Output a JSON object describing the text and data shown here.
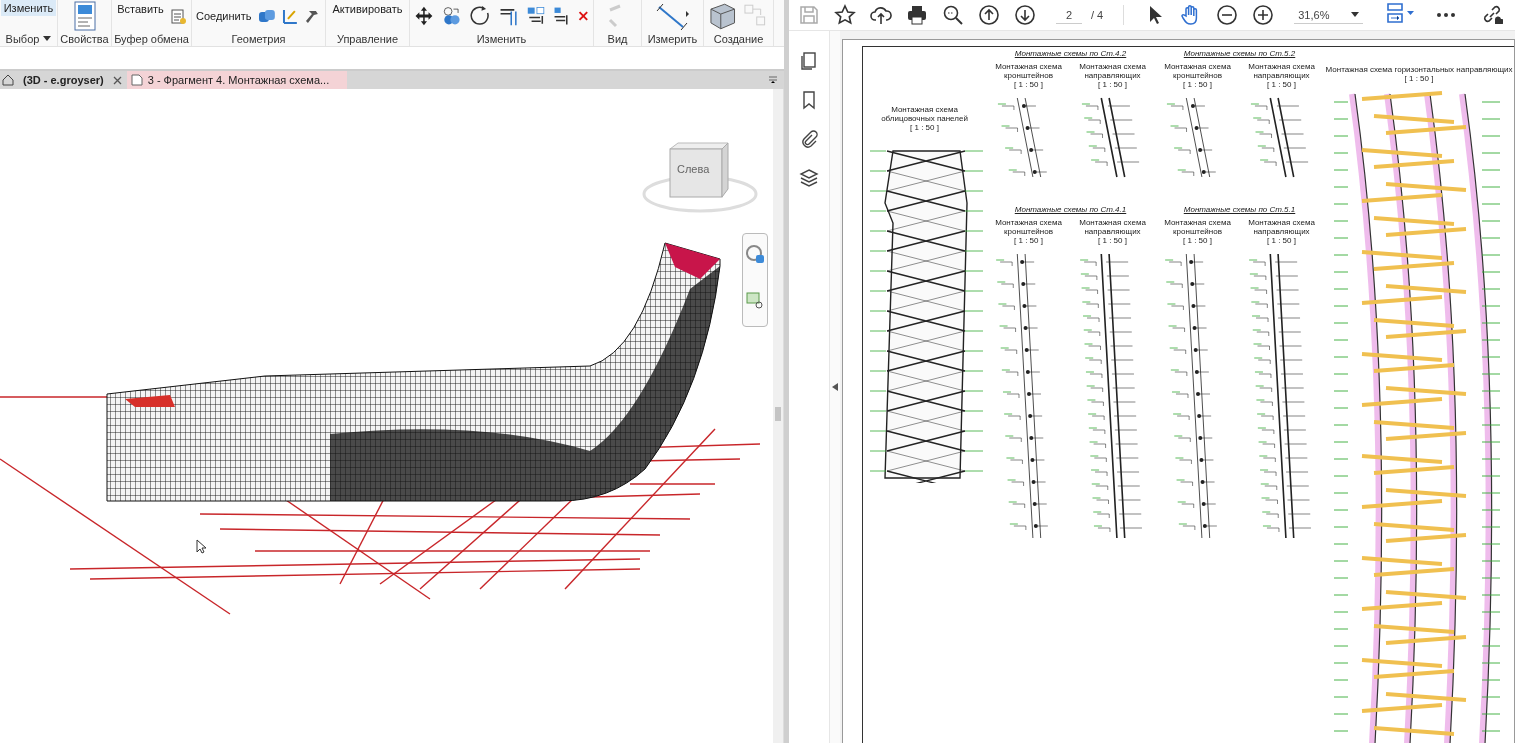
{
  "revit": {
    "ribbon_groups": [
      {
        "label": "Выбор",
        "buttons": [
          "Изменить"
        ]
      },
      {
        "label": "Свойства"
      },
      {
        "label": "Буфер обмена",
        "buttons": [
          "Вставить"
        ]
      },
      {
        "label": "Геометрия",
        "buttons": [
          "Соединить"
        ]
      },
      {
        "label": "Управление",
        "buttons": [
          "Активировать"
        ]
      },
      {
        "label": "Изменить"
      },
      {
        "label": "Вид"
      },
      {
        "label": "Измерить"
      },
      {
        "label": "Создание"
      }
    ],
    "view_tabs": [
      {
        "label": "(3D - e.groyser)",
        "selected": true
      },
      {
        "label": "3 - Фрагмент 4. Монтажная схема...",
        "selected": false
      }
    ],
    "view_cube": {
      "face": "Слева"
    }
  },
  "pdf": {
    "toolbar": {
      "page": "2",
      "pages": "/ 4",
      "zoom": "31,6%",
      "tools": [
        {
          "kind": "select",
          "selected": false
        },
        {
          "kind": "hand",
          "selected": true
        }
      ]
    },
    "sheet": {
      "panel_title": "Монтажная схема облицовочных панелей",
      "panel_scale": "[ 1 : 50 ]",
      "sections": [
        {
          "heading": "Монтажные схемы по Ст.4.2",
          "schemes": [
            {
              "title": "Монтажная схема кронштейнов",
              "scale": "[ 1 : 50 ]"
            },
            {
              "title": "Монтажная схема направляющих",
              "scale": "[ 1 : 50 ]"
            }
          ]
        },
        {
          "heading": "Монтажные схемы по Ст.5.2",
          "schemes": [
            {
              "title": "Монтажная схема кронштейнов",
              "scale": "[ 1 : 50 ]"
            },
            {
              "title": "Монтажная схема направляющих",
              "scale": "[ 1 : 50 ]"
            }
          ]
        },
        {
          "heading": "Монтажные схемы по Ст.4.1",
          "schemes": [
            {
              "title": "Монтажная схема кронштейнов",
              "scale": "[ 1 : 50 ]"
            },
            {
              "title": "Монтажная схема направляющих",
              "scale": "[ 1 : 50 ]"
            }
          ]
        },
        {
          "heading": "Монтажные схемы по Ст.5.1",
          "schemes": [
            {
              "title": "Монтажная схема кронштейнов",
              "scale": "[ 1 : 50 ]"
            },
            {
              "title": "Монтажная схема направляющих",
              "scale": "[ 1 : 50 ]"
            }
          ]
        }
      ],
      "rails_title": "Монтажная схема горизонтальных направляющих",
      "rails_scale": "[ 1 : 50 ]"
    }
  }
}
